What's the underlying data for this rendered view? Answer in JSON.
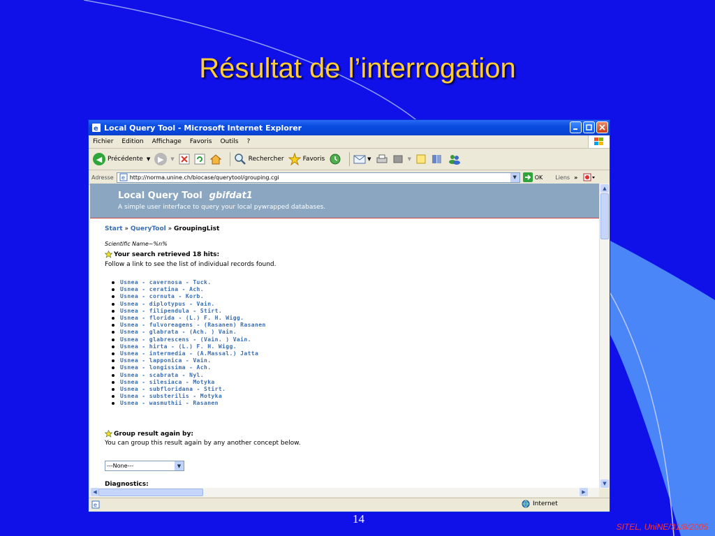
{
  "slide": {
    "title": "Résultat de l’interrogation",
    "number": "14",
    "footer": "SITEL, UniNE/31/8/2005"
  },
  "window": {
    "title": "Local Query Tool - Microsoft Internet Explorer",
    "menu": [
      "Fichier",
      "Edition",
      "Affichage",
      "Favoris",
      "Outils",
      "?"
    ]
  },
  "toolbar": {
    "back_label": "Précédente",
    "search_label": "Rechercher",
    "favorites_label": "Favoris"
  },
  "address": {
    "label": "Adresse",
    "url": "http://norma.unine.ch/biocase/querytool/grouping.cgi",
    "go_label": "OK",
    "links_label": "Liens"
  },
  "page": {
    "tool_title": "Local Query Tool",
    "db_name": "gbifdat1",
    "subtitle": "A simple user interface to query your local pywrapped databases.",
    "breadcrumb": {
      "start": "Start",
      "querytool": "QueryTool",
      "current": "GroupingList"
    },
    "query": "Scientific Name~%n%",
    "hits_heading": "Your search retrieved 18 hits:",
    "hits_note": "Follow a link to see the list of individual records found.",
    "hits": [
      "Usnea - cavernosa - Tuck.",
      "Usnea - ceratina - Ach.",
      "Usnea - cornuta - Korb.",
      "Usnea - diplotypus - Vain.",
      "Usnea - filipendula - Stirt.",
      "Usnea - florida - (L.) F. H. Wigg.",
      "Usnea - fulvoreagens - (Rasanen) Rasanen",
      "Usnea - glabrata - (Ach. ) Vain.",
      "Usnea - glabrescens - (Vain. ) Vain.",
      "Usnea - hirta - (L.) F. H. Wigg.",
      "Usnea - intermedia - (A.Massal.) Jatta",
      "Usnea - lapponica - Vain.",
      "Usnea - longissima - Ach.",
      "Usnea - scabrata - Nyl.",
      "Usnea - silesiaca - Motyka",
      "Usnea - subfloridana - Stirt.",
      "Usnea - substerilis - Motyka",
      "Usnea - wasmuthii - Rasanen"
    ],
    "group_heading": "Group result again by:",
    "group_note": "You can group this result again by any another concept below.",
    "group_select": "---None---",
    "diagnostics": "Diagnostics:"
  },
  "status": {
    "zone": "Internet"
  },
  "colors": {
    "slide_bg": "#1010e8",
    "title": "#ffcc33",
    "link": "#3a6db0",
    "header_band": "#8aa6c1"
  }
}
